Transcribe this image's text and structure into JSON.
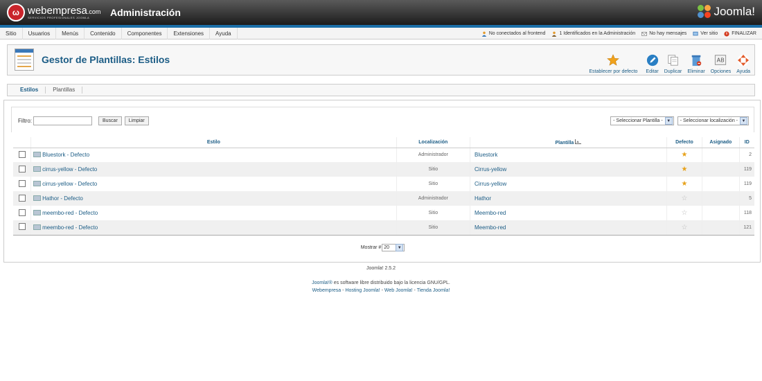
{
  "header": {
    "brand_name": "webempresa",
    "brand_suffix": ".com",
    "brand_tagline": "SERVICIOS PROFESIONALES JOOMLA",
    "title": "Administración",
    "cms_logo": "Joomla!"
  },
  "menu": [
    "Sitio",
    "Usuarios",
    "Menús",
    "Contenido",
    "Componentes",
    "Extensiones",
    "Ayuda"
  ],
  "status": {
    "frontend": "No conectados al frontend",
    "admin": "1 Identificados en la Administración",
    "messages": "No hay mensajes",
    "view_site": "Ver sitio",
    "logout": "FINALIZAR"
  },
  "page": {
    "title": "Gestor de Plantillas: Estilos"
  },
  "toolbar": [
    {
      "label": "Establecer por defecto",
      "icon": "star-icon"
    },
    {
      "label": "Editar",
      "icon": "edit-icon"
    },
    {
      "label": "Duplicar",
      "icon": "copy-icon"
    },
    {
      "label": "Eliminar",
      "icon": "trash-icon"
    },
    {
      "label": "Opciones",
      "icon": "options-icon"
    },
    {
      "label": "Ayuda",
      "icon": "help-icon"
    }
  ],
  "tabs": [
    "Estilos",
    "Plantillas"
  ],
  "filter": {
    "label": "Filtro:",
    "value": "",
    "search_button": "Buscar",
    "clear_button": "Limpiar",
    "template_select": "- Seleccionar Plantilla -",
    "location_select": "- Seleccionar localización -"
  },
  "table": {
    "headers": [
      "Estilo",
      "Localización",
      "Plantilla",
      "Defecto",
      "Asignado",
      "ID"
    ],
    "rows": [
      {
        "style": "Bluestork - Defecto",
        "location": "Administrador",
        "template": "Bluestork",
        "default": true,
        "id": "2"
      },
      {
        "style": "cirrus-yellow - Defecto",
        "location": "Sitio",
        "template": "Cirrus-yellow",
        "default": true,
        "id": "119"
      },
      {
        "style": "cirrus-yellow - Defecto",
        "location": "Sitio",
        "template": "Cirrus-yellow",
        "default": true,
        "id": "119"
      },
      {
        "style": "Hathor - Defecto",
        "location": "Administrador",
        "template": "Hathor",
        "default": false,
        "id": "5"
      },
      {
        "style": "meembo-red - Defecto",
        "location": "Sitio",
        "template": "Meembo-red",
        "default": false,
        "id": "118"
      },
      {
        "style": "meembo-red - Defecto",
        "location": "Sitio",
        "template": "Meembo-red",
        "default": false,
        "id": "121"
      }
    ]
  },
  "pager": {
    "label": "Mostrar #",
    "value": "20"
  },
  "footer": {
    "version": "Joomla! 2.5.2",
    "license_link": "Joomla!®",
    "license_text": " es software libre distribuido bajo la licencia GNU/GPL.",
    "link1": "Webempresa",
    "link2": "Hosting Joomla!",
    "link3": "Web Joomla!",
    "link4": "Tienda Joomla!",
    "sep": " - "
  },
  "colors": {
    "accent": "#1b5c85",
    "header_blue": "#1b6fa8",
    "star": "#e7a21b"
  }
}
